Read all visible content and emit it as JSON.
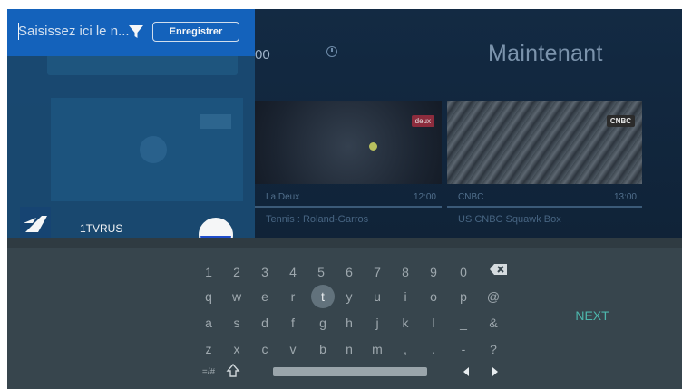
{
  "search": {
    "placeholder": "Saisissez ici le n...",
    "value": ""
  },
  "header": {
    "save_label": "Enregistrer",
    "filter_icon": "filter-icon"
  },
  "epg": {
    "time_label": "00",
    "clock_icon": "clock-icon",
    "now_label": "Maintenant",
    "programs": [
      {
        "channel": "La Deux",
        "time": "12:00",
        "title": "Tennis : Roland-Garros",
        "logo": "deux"
      },
      {
        "channel": "CNBC",
        "time": "13:00",
        "title": "US CNBC Squawk Box",
        "logo": "CNBC"
      }
    ]
  },
  "channel_list": {
    "name": "1TVRUS",
    "logo_icon": "first-channel-logo",
    "flag_icon": "russia-flag-icon"
  },
  "keyboard": {
    "row1": [
      "1",
      "2",
      "3",
      "4",
      "5",
      "6",
      "7",
      "8",
      "9",
      "0"
    ],
    "row2": [
      "q",
      "w",
      "e",
      "r",
      "t",
      "y",
      "u",
      "i",
      "o",
      "p",
      "@"
    ],
    "row3": [
      "a",
      "s",
      "d",
      "f",
      "g",
      "h",
      "j",
      "k",
      "l",
      "_",
      "&"
    ],
    "row4": [
      "z",
      "x",
      "c",
      "v",
      "b",
      "n",
      "m",
      ",",
      ".",
      "-",
      "?"
    ],
    "mode_label": "=/#",
    "next_label": "NEXT",
    "focused_key": "t",
    "icons": {
      "backspace": "backspace-icon",
      "shift": "shift-icon",
      "left": "arrow-left-icon",
      "right": "arrow-right-icon"
    }
  }
}
